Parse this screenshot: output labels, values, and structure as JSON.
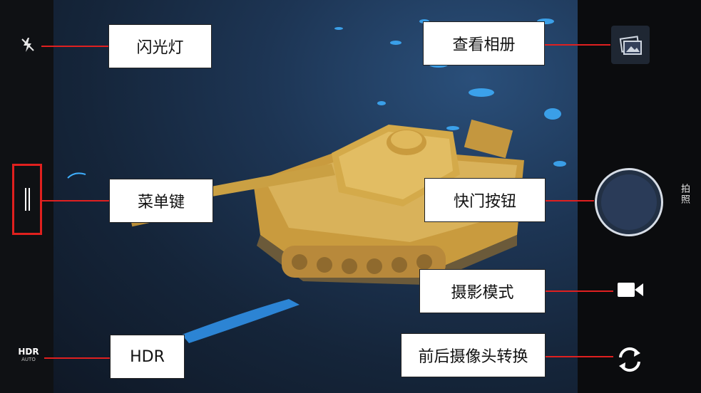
{
  "left_bar": {
    "flash_icon": "flash-off-icon",
    "menu_icon": "menu-icon",
    "hdr_label": "HDR",
    "hdr_sub": "AUTO"
  },
  "right_bar": {
    "gallery_icon": "gallery-icon",
    "shutter_label": "拍照",
    "video_icon": "video-camera-icon",
    "switch_icon": "switch-camera-icon"
  },
  "callouts": {
    "flash": "闪光灯",
    "menu": "菜单键",
    "hdr": "HDR",
    "gallery": "查看相册",
    "shutter": "快门按钮",
    "mode": "摄影模式",
    "switch": "前后摄像头转换"
  },
  "colors": {
    "callout_line": "#e02020",
    "highlight_box": "#e0201e",
    "tank": "#d4aa4a"
  }
}
